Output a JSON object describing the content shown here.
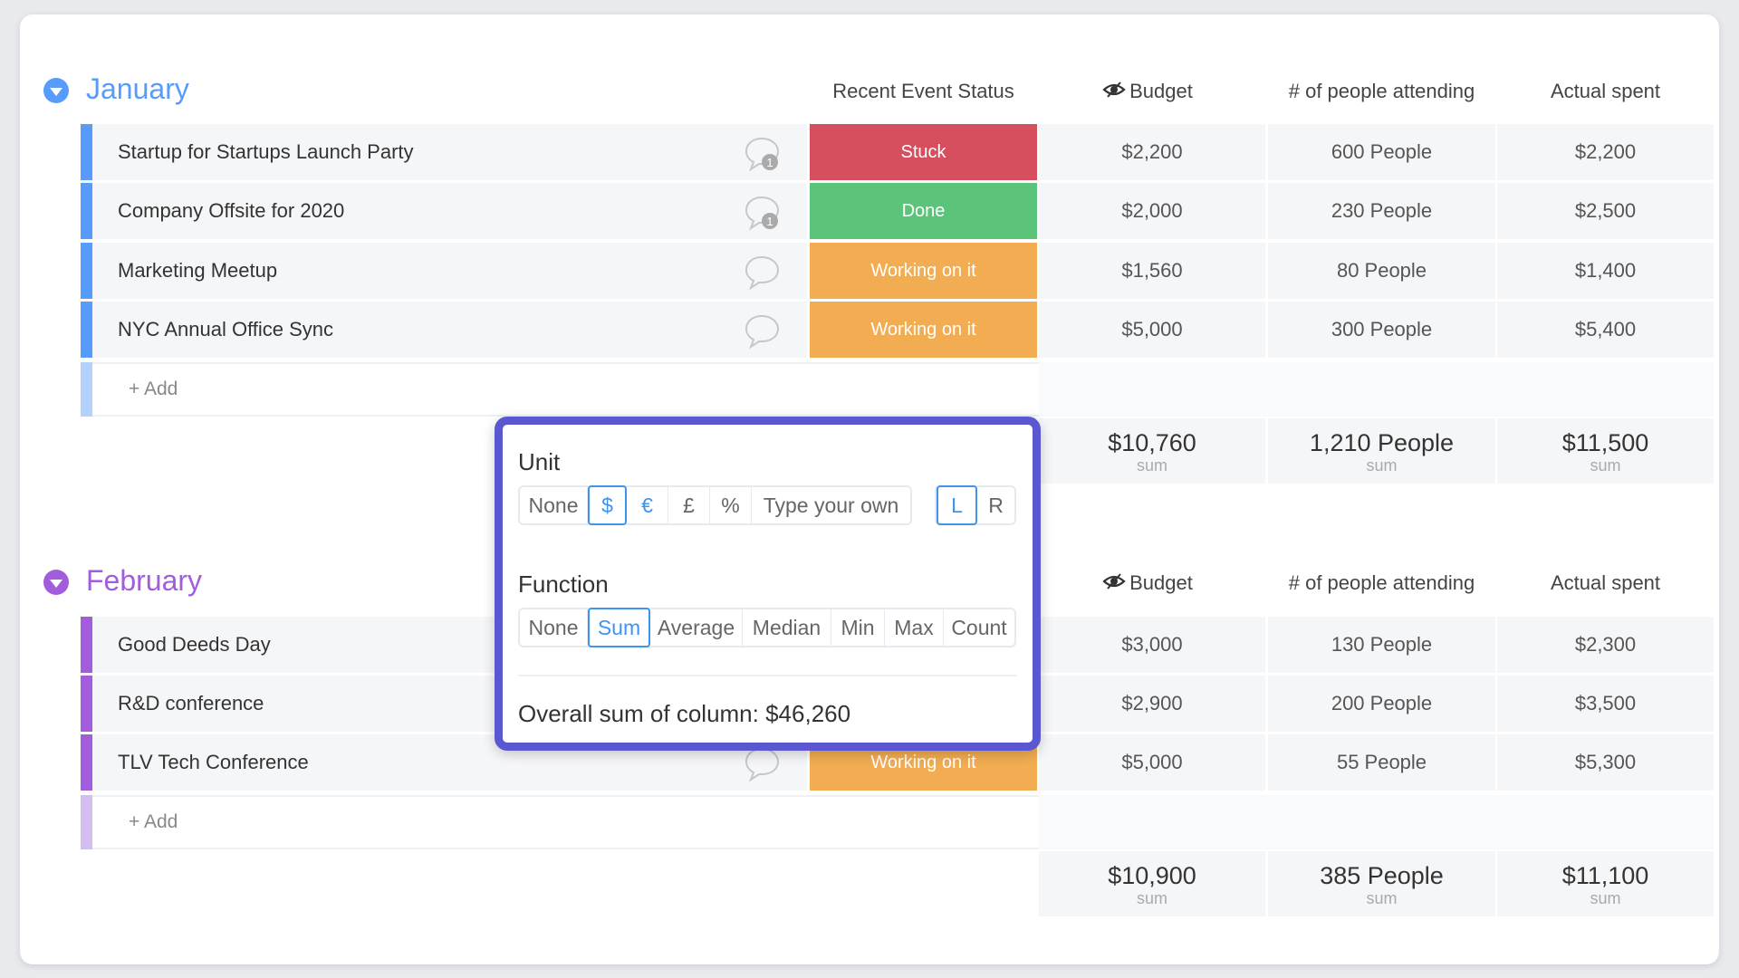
{
  "colors": {
    "january": "#579bfc",
    "february": "#a25ddc",
    "stuck": "#d54f5e",
    "done": "#5cc47a",
    "working": "#f2ad52",
    "popup_border": "#5b57d1",
    "selected": "#3d95f0"
  },
  "columns": {
    "status": "Recent Event Status",
    "budget": "Budget",
    "people": "# of people attending",
    "actual": "Actual spent",
    "budget_icon": "eye-icon"
  },
  "groups": [
    {
      "title": "January",
      "add_label": "+ Add",
      "rows": [
        {
          "name": "Startup for Startups Launch Party",
          "comments": "1",
          "status": "Stuck",
          "budget": "$2,200",
          "people": "600 People",
          "actual": "$2,200"
        },
        {
          "name": "Company Offsite for 2020",
          "comments": "1",
          "status": "Done",
          "budget": "$2,000",
          "people": "230 People",
          "actual": "$2,500"
        },
        {
          "name": "Marketing Meetup",
          "comments": "",
          "status": "Working on it",
          "budget": "$1,560",
          "people": "80 People",
          "actual": "$1,400"
        },
        {
          "name": "NYC Annual Office Sync",
          "comments": "",
          "status": "Working on it",
          "budget": "$5,000",
          "people": "300 People",
          "actual": "$5,400"
        }
      ],
      "sums": {
        "budget": "$10,760",
        "people": "1,210 People",
        "actual": "$11,500",
        "label": "sum"
      }
    },
    {
      "title": "February",
      "add_label": "+ Add",
      "rows": [
        {
          "name": "Good Deeds Day",
          "budget": "$3,000",
          "people": "130 People",
          "actual": "$2,300"
        },
        {
          "name": "R&D conference",
          "budget": "$2,900",
          "people": "200 People",
          "actual": "$3,500"
        },
        {
          "name": "TLV Tech Conference",
          "comments": "",
          "status": "Working on it",
          "budget": "$5,000",
          "people": "55 People",
          "actual": "$5,300"
        }
      ],
      "sums": {
        "budget": "$10,900",
        "people": "385 People",
        "actual": "$11,100",
        "label": "sum"
      }
    }
  ],
  "popup": {
    "unit_label": "Unit",
    "units": [
      "None",
      "$",
      "€",
      "£",
      "%",
      "Type your own"
    ],
    "unit_selected": "$",
    "align": [
      "L",
      "R"
    ],
    "align_selected": "L",
    "function_label": "Function",
    "functions": [
      "None",
      "Sum",
      "Average",
      "Median",
      "Min",
      "Max",
      "Count"
    ],
    "function_selected": "Sum",
    "summary": "Overall sum of column: $46,260"
  }
}
